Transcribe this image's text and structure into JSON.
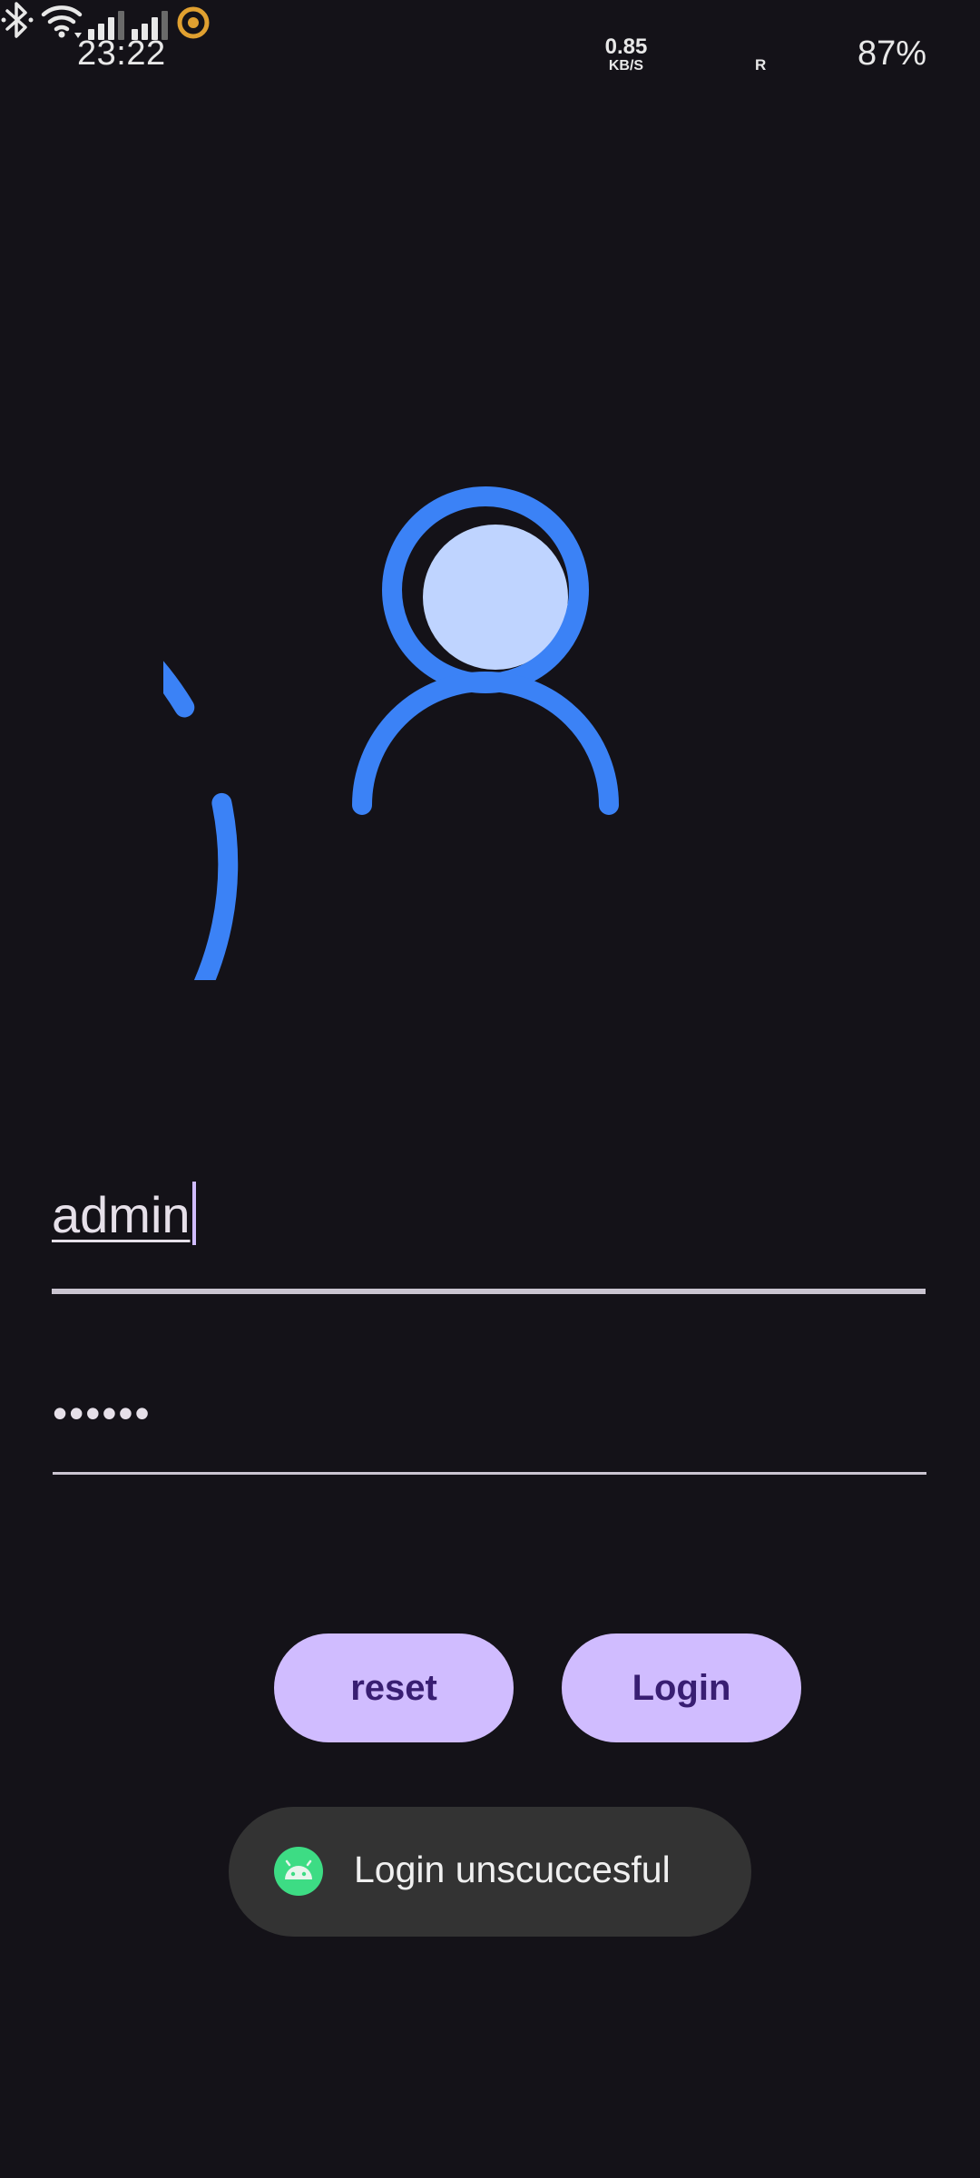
{
  "status_bar": {
    "time": "23:22",
    "net_speed_value": "0.85",
    "net_speed_unit": "KB/S",
    "roaming_indicator": "R",
    "battery_percent": "87%",
    "icons": [
      "bluetooth-icon",
      "wifi-icon",
      "signal-icon",
      "signal-roaming-icon",
      "battery-saver-icon"
    ],
    "battery_saver_color": "#e0a030"
  },
  "avatar": {
    "icon": "account-circle-icon",
    "ring_color": "#3b82f6",
    "head_fill_color": "#bfd4ff"
  },
  "form": {
    "username_value": "admin",
    "password_value": "••••••"
  },
  "buttons": {
    "reset_label": "reset",
    "login_label": "Login"
  },
  "toast": {
    "message": "Login unscuccesful",
    "icon": "android-icon",
    "icon_color": "#3ddc84"
  },
  "colors": {
    "background": "#141218",
    "button_fill": "#d0bcff",
    "button_text": "#381e72",
    "toast_background": "#333333"
  }
}
